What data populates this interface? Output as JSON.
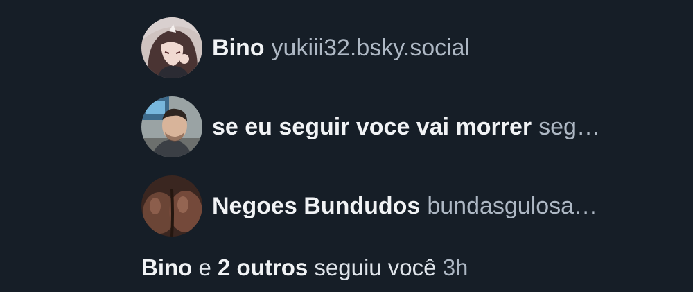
{
  "followers": [
    {
      "display_name": "Bino",
      "handle": "yukiii32.bsky.social",
      "avatar_icon": "anime-character-avatar"
    },
    {
      "display_name": "se eu seguir voce vai morrer",
      "handle": "seg…",
      "avatar_icon": "man-photo-avatar"
    },
    {
      "display_name": "Negoes Bundudos",
      "handle": "bundasgulosa…",
      "avatar_icon": "dark-skin-photo-avatar"
    }
  ],
  "summary": {
    "first_name": "Bino",
    "connector": "e",
    "others": "2 outros",
    "action": "seguiu você",
    "time": "3h"
  },
  "colors": {
    "background": "#161e27",
    "name_text": "#f1f3f5",
    "handle_text": "#aeb8c4"
  }
}
